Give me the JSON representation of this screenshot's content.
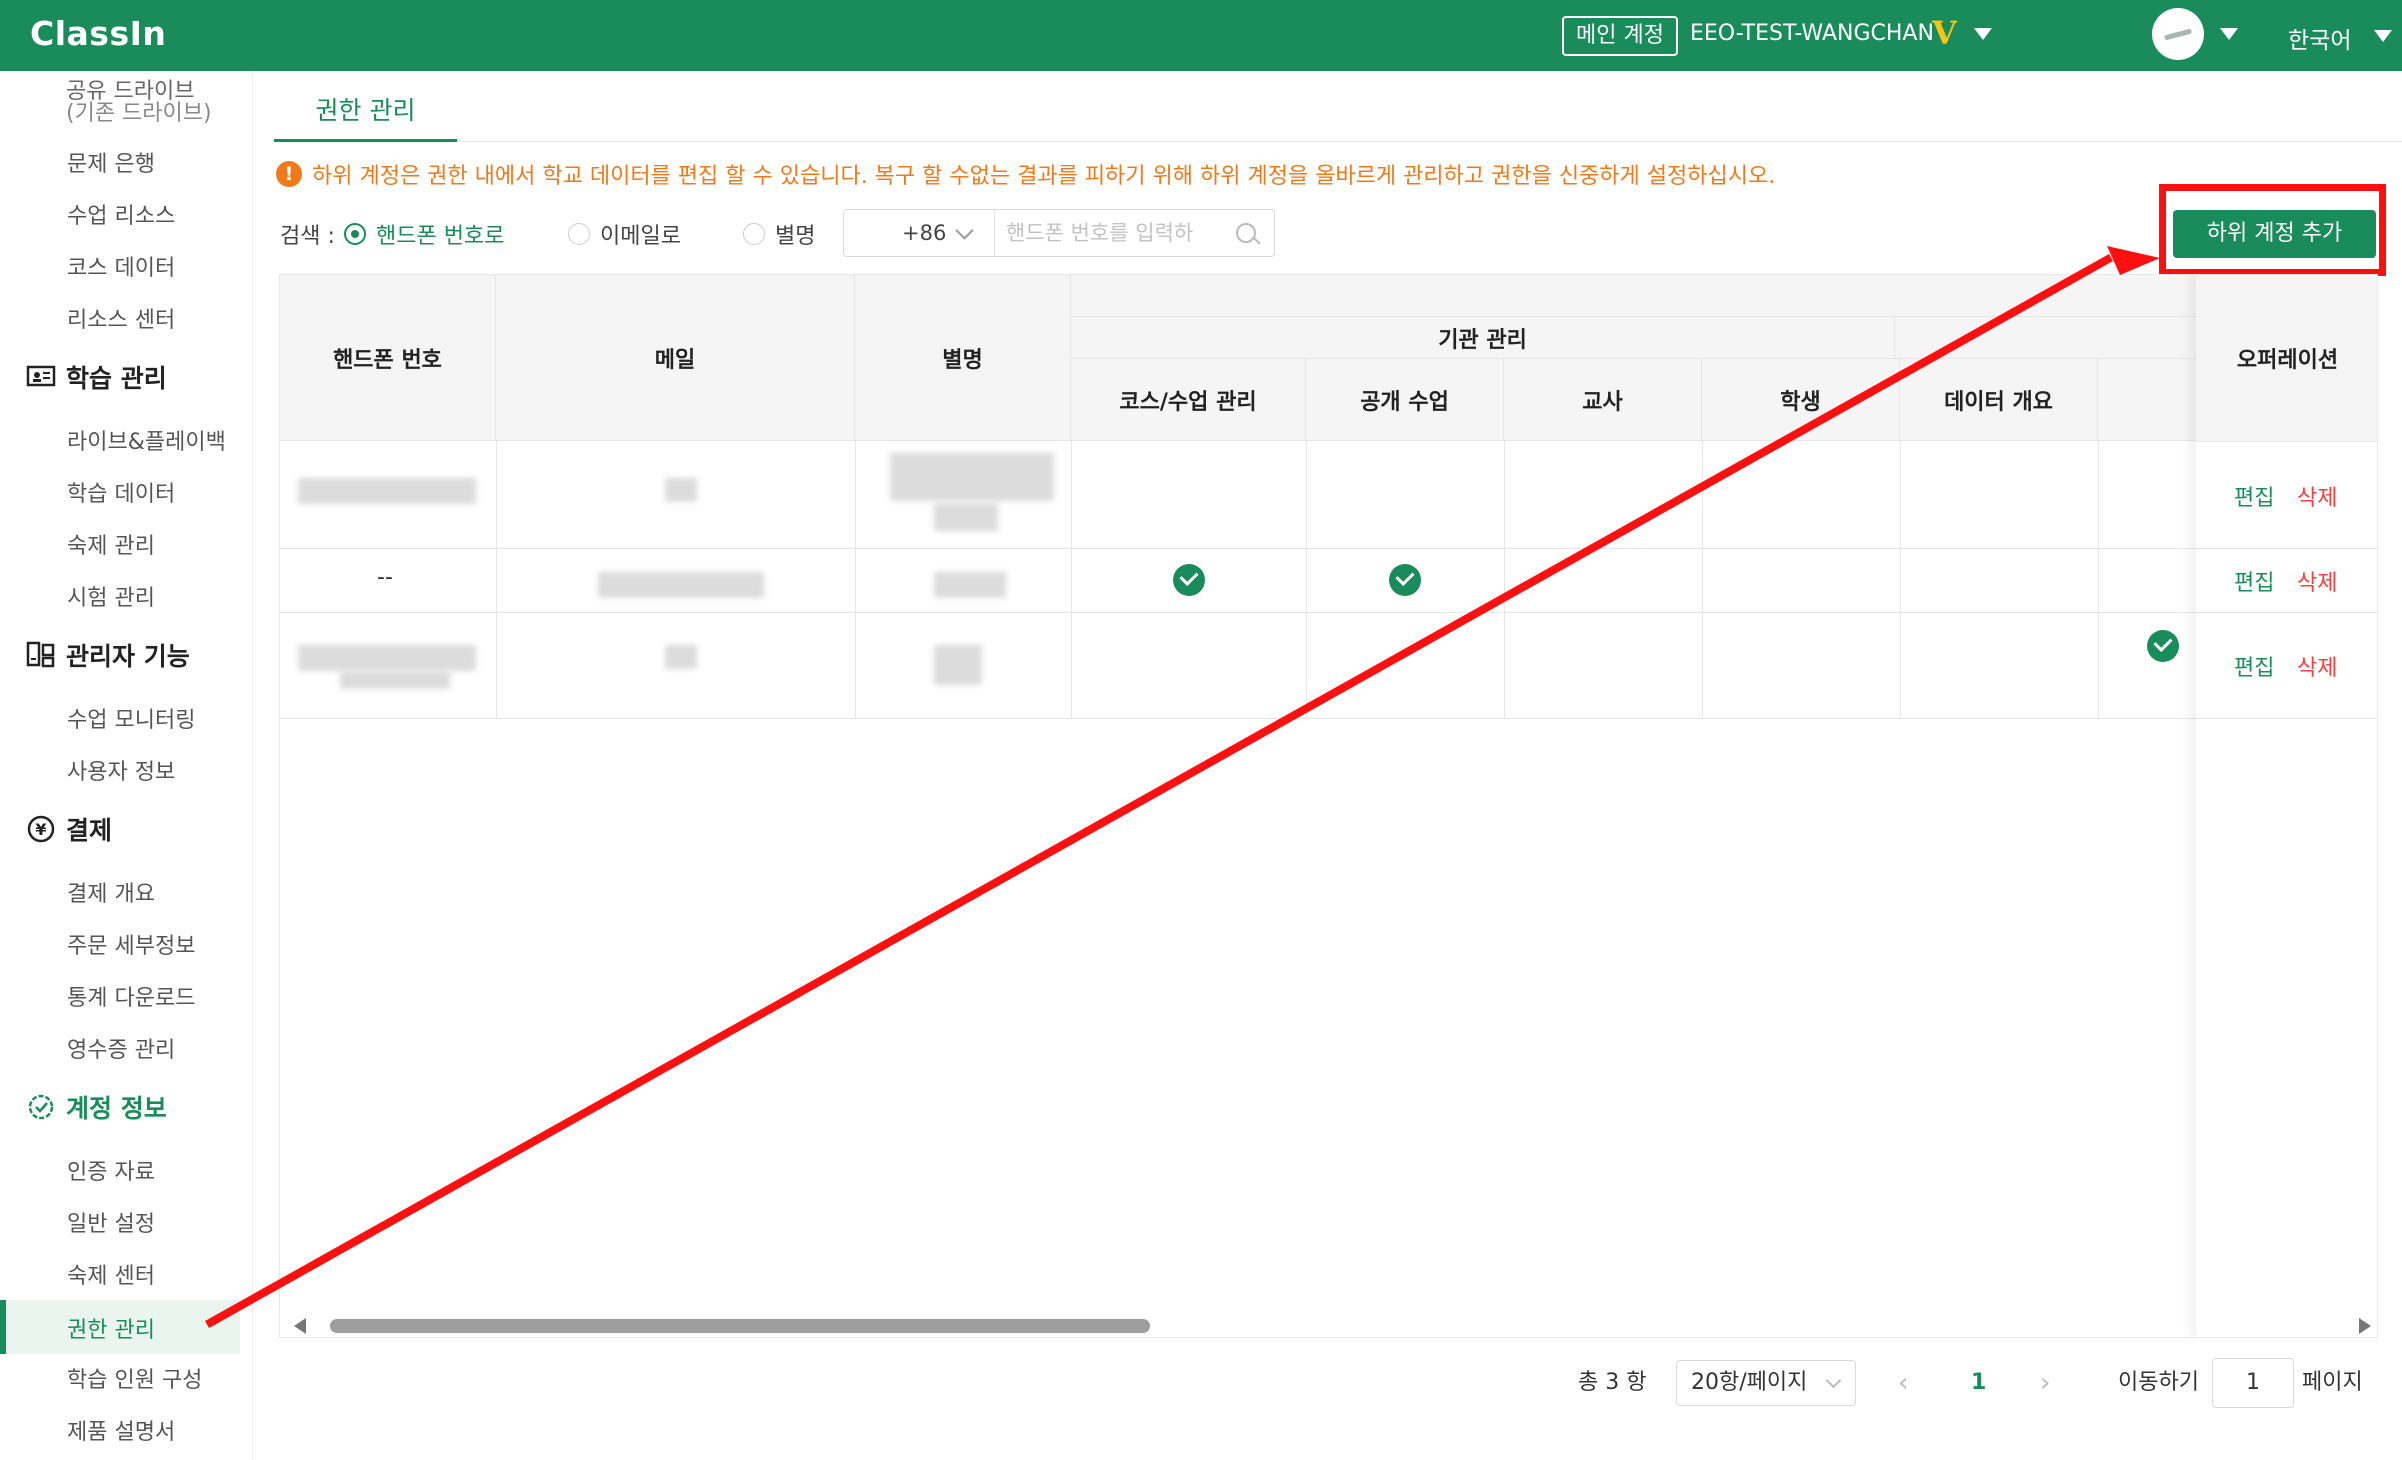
{
  "topbar": {
    "logo": "ClassIn",
    "main_account_tag": "메인 계정",
    "account_name": "EEO-TEST-WANGCHAN",
    "vip_badge": "V",
    "language": "한국어"
  },
  "sidebar": {
    "top_item_line1": "공유 드라이브",
    "top_item_line2": "(기존 드라이브)",
    "items_group1": [
      "문제 은행",
      "수업 리소스",
      "코스 데이터",
      "리소스 센터"
    ],
    "section_learning": "학습 관리",
    "items_learning": [
      "라이브&플레이백",
      "학습 데이터",
      "숙제 관리",
      "시험 관리"
    ],
    "section_admin": "관리자 기능",
    "items_admin": [
      "수업 모니터링",
      "사용자 정보"
    ],
    "section_payment": "결제",
    "items_payment": [
      "결제 개요",
      "주문 세부정보",
      "통계 다운로드",
      "영수증 관리"
    ],
    "section_account": "계정 정보",
    "items_account": [
      "인증 자료",
      "일반 설정",
      "숙제 센터",
      "권한 관리",
      "학습 인원 구성",
      "제품 설명서"
    ]
  },
  "tab": {
    "label": "권한 관리"
  },
  "warning": "하위 계정은 권한 내에서 학교 데이터를 편집 할 수 있습니다. 복구 할 수없는 결과를 피하기 위해 하위 계정을 올바르게 관리하고 권한을 신중하게 설정하십시오.",
  "search": {
    "label": "검색 :",
    "options": [
      "핸드폰 번호로",
      "이메일로",
      "별명"
    ],
    "selected_index": 0,
    "country_code": "+86",
    "placeholder": "핸드폰 번호를 입력하"
  },
  "add_button": "하위 계정 추가",
  "table": {
    "headers": {
      "phone": "핸드폰 번호",
      "email": "메일",
      "nickname": "별명",
      "group": "기관 관리",
      "sub": [
        "코스/수업 관리",
        "공개 수업",
        "교사",
        "학생",
        "데이터 개요"
      ],
      "operations": "오퍼레이션"
    },
    "rows": [
      {
        "phone": "",
        "email": "",
        "nickname": "",
        "checks": []
      },
      {
        "phone": "--",
        "email": "",
        "nickname": "",
        "checks": [
          "코스/수업 관리",
          "공개 수업"
        ]
      },
      {
        "phone": "",
        "email": "",
        "nickname": "",
        "checks": []
      }
    ],
    "edit_label": "편집",
    "delete_label": "삭제"
  },
  "pagination": {
    "total": "총 3 항",
    "page_size": "20항/페이지",
    "current_page": "1",
    "goto_label": "이동하기",
    "goto_value": "1",
    "page_suffix": "페이지"
  },
  "colors": {
    "brand": "#1a8c5b",
    "warning": "#f07a1a",
    "annotation": "#ff1010",
    "delete": "#f04141"
  }
}
